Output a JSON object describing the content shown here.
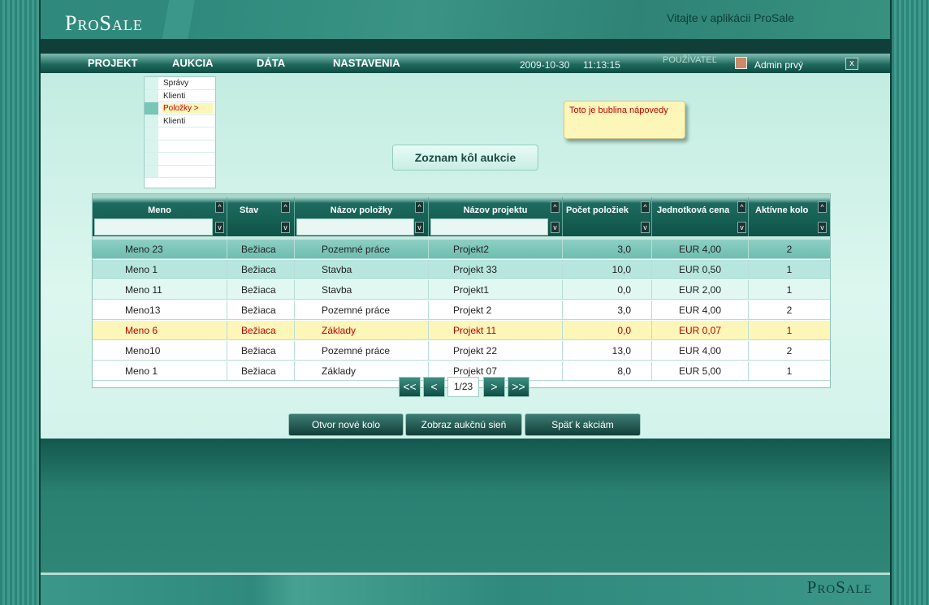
{
  "app": {
    "logo": "ProSale",
    "welcome": "Vitajte v aplikácii ProSale",
    "footer_logo": "ProSale"
  },
  "nav": {
    "items": [
      "PROJEKT",
      "AUKCIA",
      "DÁTA",
      "NASTAVENIA"
    ],
    "date": "2009-10-30",
    "time": "11:13:15",
    "user_label": "POUŽÍVATEĽ",
    "user_name": "Admin prvý",
    "close": "x"
  },
  "submenu": {
    "items": [
      "Správy",
      "Klienti",
      "Položky  >",
      "Klienti",
      "",
      "",
      "",
      ""
    ]
  },
  "help_bubble": "Toto je bublina nápovedy",
  "list_title": "Zoznam kôl aukcie",
  "table": {
    "headers": [
      "Meno",
      "Stav",
      "Názov položky",
      "Názov projektu",
      "Počet položiek",
      "Jednotková cena",
      "Aktívne kolo"
    ],
    "sort_up": "^",
    "sort_down": "v",
    "rows": [
      [
        "Meno 23",
        "Bežiaca",
        "Pozemné práce",
        "Projekt2",
        "3,0",
        "EUR 4,00",
        "2"
      ],
      [
        "Meno 1",
        "Bežiaca",
        "Stavba",
        "Projekt 33",
        "10,0",
        "EUR 0,50",
        "1"
      ],
      [
        "Meno 11",
        "Bežiaca",
        "Stavba",
        "Projekt1",
        "0,0",
        "EUR 2,00",
        "1"
      ],
      [
        "Meno13",
        "Bežiaca",
        "Pozemné práce",
        "Projekt 2",
        "3,0",
        "EUR 4,00",
        "2"
      ],
      [
        "Meno 6",
        "Bežiaca",
        "Základy",
        "Projekt 11",
        "0,0",
        "EUR 0,07",
        "1"
      ],
      [
        "Meno10",
        "Bežiaca",
        "Pozemné práce",
        "Projekt 22",
        "13,0",
        "EUR 4,00",
        "2"
      ],
      [
        "Meno 1",
        "Bežiaca",
        "Základy",
        "Projekt 07",
        "8,0",
        "EUR 5,00",
        "1"
      ]
    ],
    "highlighted_row": 4
  },
  "actions": {
    "open_round": "Otvor nové kolo",
    "show_hall": "Zobraz aukčnú sieň",
    "back": "Späť k akciám"
  },
  "pager": {
    "first": "<<",
    "prev": "<",
    "page": "1/23",
    "next": ">",
    "last": ">>"
  },
  "colors": {
    "accent": "#1d6b5f",
    "highlight": "#fdf6b9",
    "alert_text": "#c00000"
  }
}
